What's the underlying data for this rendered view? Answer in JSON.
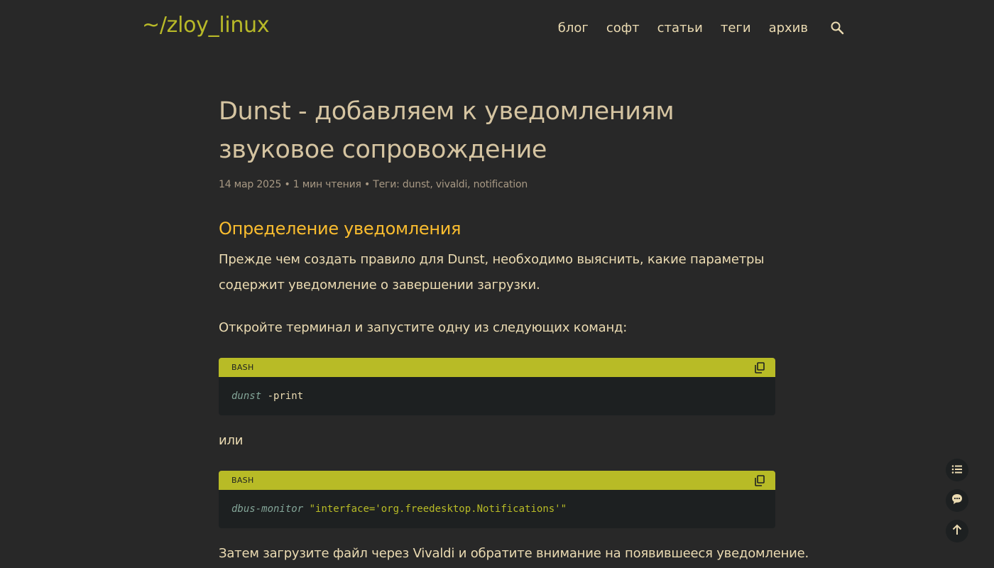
{
  "site": {
    "logo": "~/zloy_linux"
  },
  "nav": {
    "items": [
      "блог",
      "софт",
      "статьи",
      "теги",
      "архив"
    ]
  },
  "post": {
    "title": "Dunst - добавляем к уведомлениям звуковое сопровождение",
    "meta": {
      "date": "14 мар 2025",
      "separator": "•",
      "read_time": "1 мин чтения",
      "tags_label": "Теги:",
      "tags": [
        "dunst",
        "vivaldi",
        "notification"
      ]
    },
    "section_heading": "Определение уведомления",
    "para1": "Прежде чем создать правило для Dunst, необходимо выяснить, какие параметры содержит уведомление о завершении загрузки.",
    "para2": "Откройте терминал и запустите одну из следующих команд:",
    "code1": {
      "lang": "BASH",
      "cmd": "dunst",
      "args": " -print"
    },
    "or_text": "или",
    "code2": {
      "lang": "BASH",
      "cmd": "dbus-monitor",
      "args": " ",
      "string": "\"interface='org.freedesktop.Notifications'\""
    },
    "para3": "Затем загрузите файл через Vivaldi и обратите внимание на появившееся уведомление."
  },
  "icons": {
    "search": "search-icon",
    "copy": "copy-icon",
    "toc": "list-icon",
    "comments": "comment-icon",
    "top": "arrow-up-icon"
  },
  "colors": {
    "background": "#282828",
    "logo": "#b8b928",
    "heading": "#fabd2f",
    "code_header": "#b8bb26",
    "code_bg": "#1d2021"
  }
}
